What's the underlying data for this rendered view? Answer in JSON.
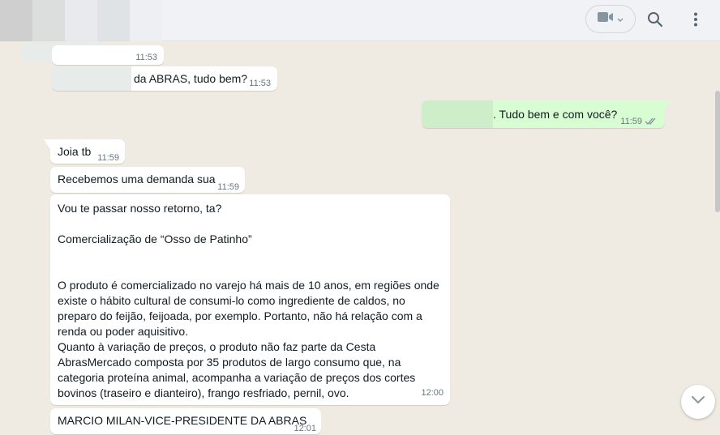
{
  "header": {
    "video_icon": "video-camera-icon",
    "search_icon": "search-icon",
    "menu_icon": "kebab-menu-icon"
  },
  "messages": [
    {
      "dir": "in",
      "text": "",
      "time": "11:53"
    },
    {
      "dir": "in",
      "text": "da ABRAS, tudo bem?",
      "time": "11:53"
    },
    {
      "dir": "out",
      "text": ". Tudo bem e com você?",
      "time": "11:59",
      "status": "read"
    },
    {
      "dir": "in",
      "text": "Joia tb",
      "time": "11:59"
    },
    {
      "dir": "in",
      "text": "Recebemos uma demanda sua",
      "time": "11:59"
    },
    {
      "dir": "in",
      "text": "Vou te passar nosso retorno, ta?\n\nComercialização de “Osso de Patinho”\n\n\nO produto é comercializado no varejo há mais de 10 anos, em regiões onde existe o hábito cultural de consumi-lo como ingrediente de caldos, no preparo do feijão, feijoada, por exemplo. Portanto, não há relação com a renda ou poder aquisitivo.\nQuanto à variação de preços, o produto não faz parte da Cesta AbrasMercado composta por 35 produtos de largo consumo que, na categoria proteína animal, acompanha a variação de preços dos cortes bovinos (traseiro e dianteiro), frango resfriado, pernil, ovo.",
      "time": "12:00"
    },
    {
      "dir": "in",
      "text": "MARCIO MILAN-VICE-PRESIDENTE DA ABRAS",
      "time": "12:01"
    }
  ],
  "colors": {
    "chat_bg": "#efeae2",
    "incoming": "#ffffff",
    "outgoing": "#d9fdd3",
    "read_ticks": "#53bdeb"
  }
}
